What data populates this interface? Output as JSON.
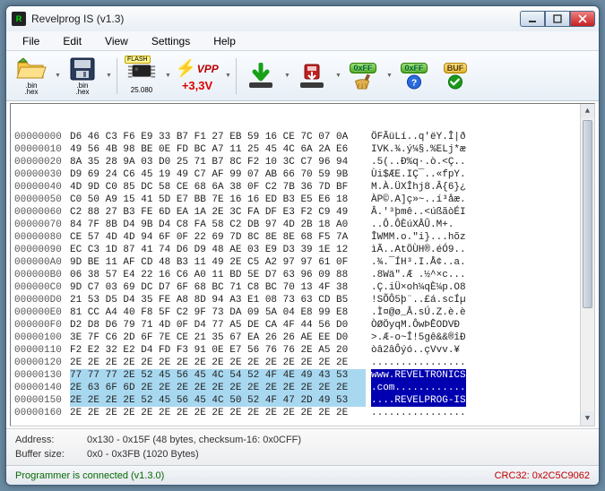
{
  "window": {
    "title": "Revelprog IS (v1.3)"
  },
  "menu": {
    "items": [
      "File",
      "Edit",
      "View",
      "Settings",
      "Help"
    ]
  },
  "toolbar": {
    "open_label": ".bin\n.hex",
    "save_label": ".bin\n.hex",
    "chip_caption": "25.080",
    "vpp_top": "VPP",
    "vpp_val": "+3,3V",
    "ff_hex": "0xFF",
    "ff2_hex": "0xFF",
    "buf_label": "BUF"
  },
  "hex": {
    "rows": [
      {
        "addr": "00000000",
        "bytes": "D6 46 C3 F6 E9 33 B7 F1 27 EB 59 16 CE 7C 07 0A",
        "ascii": "ÖFÃüLí..q'ëY.Î|ð"
      },
      {
        "addr": "00000010",
        "bytes": "49 56 4B 98 BE 0E FD BC A7 11 25 45 4C 6A 2A E6",
        "ascii": "IVK.¾.ý¼§.%ELj*æ"
      },
      {
        "addr": "00000020",
        "bytes": "8A 35 28 9A 03 D0 25 71 B7 8C F2 10 3C C7 96 94",
        "ascii": ".5(..Ð%q·.ò.<Ç.."
      },
      {
        "addr": "00000030",
        "bytes": "D9 69 24 C6 45 19 49 C7 AF 99 07 AB 66 70 59 9B",
        "ascii": "Ùi$ÆE.IÇ¯..«fpY."
      },
      {
        "addr": "00000040",
        "bytes": "4D 9D C0 85 DC 58 CE 68 6A 38 0F C2 7B 36 7D BF",
        "ascii": "M.À.ÜXÎhj8.Â{6}¿"
      },
      {
        "addr": "00000050",
        "bytes": "C0 50 A9 15 41 5D E7 BB 7E 16 16 ED B3 E5 E6 18",
        "ascii": "ÀP©.A]ç»~..í³åæ."
      },
      {
        "addr": "00000060",
        "bytes": "C2 88 27 B3 FE 6D EA 1A 2E 3C FA DF E3 F2 C9 49",
        "ascii": "Â.'³þmê..<úßãòÉI"
      },
      {
        "addr": "00000070",
        "bytes": "84 7F 8B D4 9B D4 C8 FA 58 C2 DB 97 4D 2B 18 A0",
        "ascii": "..Ô.ÔÈúXÂÛ.M+. "
      },
      {
        "addr": "00000080",
        "bytes": "CE 57 4D 4D 94 6F 0F 22 69 7D 8C 8E 8E 68 F5 7A",
        "ascii": "ÎWMM.o.\"i}...hõz"
      },
      {
        "addr": "00000090",
        "bytes": "EC C3 1D 87 41 74 D6 D9 48 AE 03 E9 D3 39 1E 12",
        "ascii": "ìÃ..AtÖÙH®.éÓ9.."
      },
      {
        "addr": "000000A0",
        "bytes": "9D BE 11 AF CD 48 B3 11 49 2E C5 A2 97 97 61 0F",
        "ascii": ".¾.¯ÍH³.I.Å¢..a."
      },
      {
        "addr": "000000B0",
        "bytes": "06 38 57 E4 22 16 C6 A0 11 BD 5E D7 63 96 09 88",
        "ascii": ".8Wä\".Æ .½^×c..."
      },
      {
        "addr": "000000C0",
        "bytes": "9D C7 03 69 DC D7 6F 68 BC 71 C8 BC 70 13 4F 38",
        "ascii": ".Ç.iÜ×oh¼qÈ¼p.O8"
      },
      {
        "addr": "000000D0",
        "bytes": "21 53 D5 D4 35 FE A8 8D 94 A3 E1 08 73 63 CD B5",
        "ascii": "!SÕÔ5þ¨..£á.scÍµ"
      },
      {
        "addr": "000000E0",
        "bytes": "81 CC A4 40 F8 5F C2 9F 73 DA 09 5A 04 E8 99 E8",
        "ascii": ".Ì¤@ø_Â.sÚ.Z.è.è"
      },
      {
        "addr": "000000F0",
        "bytes": "D2 D8 D6 79 71 4D 0F D4 77 A5 DE CA 4F 44 56 D0",
        "ascii": "ÒØÖyqM.ÔwÞÊODVÐ"
      },
      {
        "addr": "00000100",
        "bytes": "3E 7F C6 2D 6F 7E CE 21 35 67 EA 26 26 AE EE D0",
        "ascii": ">.Æ-o~Î!5gê&&®îÐ"
      },
      {
        "addr": "00000110",
        "bytes": "F2 E2 32 E2 D4 FD F3 91 0E E7 56 76 76 2E A5 20",
        "ascii": "òâ2âÔýó..çVvv.¥ "
      },
      {
        "addr": "00000120",
        "bytes": "2E 2E 2E 2E 2E 2E 2E 2E 2E 2E 2E 2E 2E 2E 2E 2E",
        "ascii": "................"
      },
      {
        "addr": "00000130",
        "bytes": "77 77 77 2E 52 45 56 45 4C 54 52 4F 4E 49 43 53",
        "ascii": "www.REVELTRONICS",
        "sel": true
      },
      {
        "addr": "00000140",
        "bytes": "2E 63 6F 6D 2E 2E 2E 2E 2E 2E 2E 2E 2E 2E 2E 2E",
        "ascii": ".com............",
        "sel": true
      },
      {
        "addr": "00000150",
        "bytes": "2E 2E 2E 2E 52 45 56 45 4C 50 52 4F 47 2D 49 53",
        "ascii": "....REVELPROG-IS",
        "selBytesFrom": 0,
        "selAsciiFrom": 0,
        "partial": true
      },
      {
        "addr": "00000160",
        "bytes": "2E 2E 2E 2E 2E 2E 2E 2E 2E 2E 2E 2E 2E 2E 2E 2E",
        "ascii": "................"
      }
    ]
  },
  "info": {
    "address_label": "Address:",
    "address_value": "0x130 - 0x15F (48 bytes, checksum-16: 0x0CFF)",
    "buffer_label": "Buffer size:",
    "buffer_value": "0x0 - 0x3FB (1020 Bytes)"
  },
  "status": {
    "text": "Programmer is connected (v1.3.0)",
    "crc_label": "CRC32: 0x2C5C9062"
  }
}
